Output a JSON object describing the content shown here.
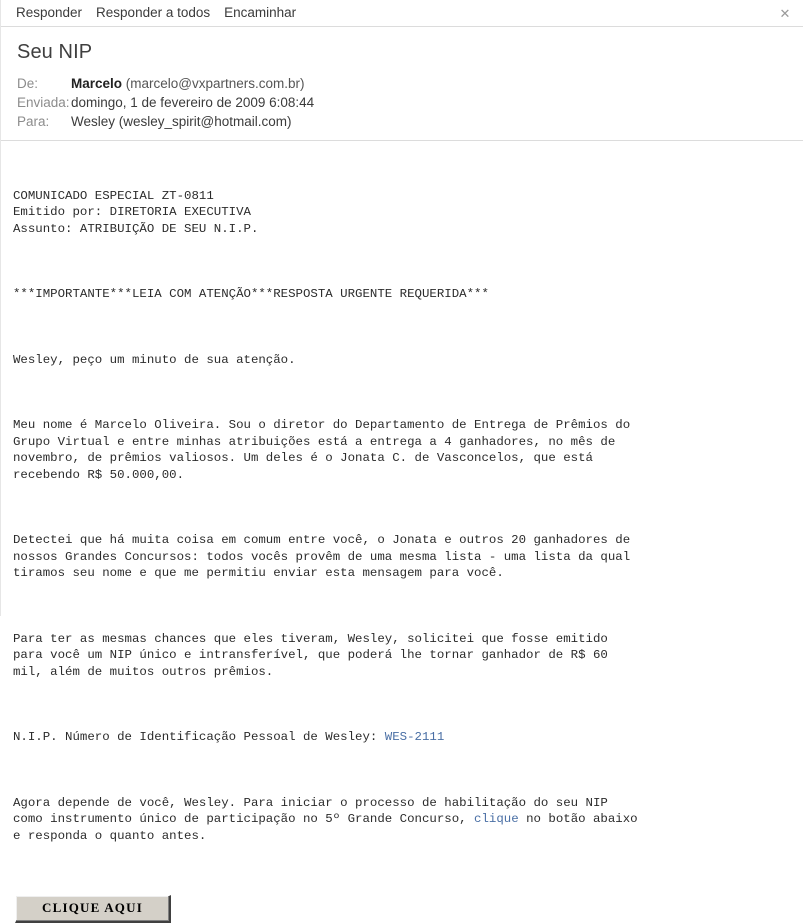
{
  "toolbar": {
    "actions": [
      {
        "label": "Responder",
        "name": "reply-button"
      },
      {
        "label": "Responder a todos",
        "name": "reply-all-button"
      },
      {
        "label": "Encaminhar",
        "name": "forward-button"
      }
    ],
    "close_icon": "✕"
  },
  "message": {
    "subject": "Seu NIP",
    "fields": {
      "from_label": "De:",
      "from_name": "Marcelo",
      "from_address": "(marcelo@vxpartners.com.br)",
      "sent_label": "Enviada:",
      "sent_value": "domingo, 1 de fevereiro de 2009 6:08:44",
      "to_label": "Para:",
      "to_value": "Wesley (wesley_spirit@hotmail.com)"
    },
    "body": {
      "block_header": "COMUNICADO ESPECIAL ZT-0811\nEmitido por: DIRETORIA EXECUTIVA\nAssunto: ATRIBUIÇÃO DE SEU N.I.P.",
      "attention_line": "***IMPORTANTE***LEIA COM ATENÇÃO***RESPOSTA URGENTE REQUERIDA***",
      "greeting": "Wesley, peço um minuto de sua atenção.",
      "paragraph_1": "Meu nome é Marcelo Oliveira. Sou o diretor do Departamento de Entrega de Prêmios do\nGrupo Virtual e entre minhas atribuições está a entrega a 4 ganhadores, no mês de\nnovembro, de prêmios valiosos. Um deles é o Jonata C. de Vasconcelos, que está\nrecebendo R$ 50.000,00.",
      "paragraph_2": "Detectei que há muita coisa em comum entre você, o Jonata e outros 20 ganhadores de\nnossos Grandes Concursos: todos vocês provêm de uma mesma lista - uma lista da qual\ntiramos seu nome e que me permitiu enviar esta mensagem para você.",
      "paragraph_3": "Para ter as mesmas chances que eles tiveram, Wesley, solicitei que fosse emitido\npara você um NIP único e intransferível, que poderá lhe tornar ganhador de R$ 60\nmil, além de muitos outros prêmios.",
      "nip_line_prefix": "N.I.P. Número de Identificação Pessoal de Wesley: ",
      "nip_code": "WES-2111",
      "closing_part_1": "Agora depende de você, Wesley. Para iniciar o processo de habilitação do seu NIP\ncomo instrumento único de participação no 5º Grande Concurso, ",
      "closing_link": "clique",
      "closing_part_2": " no botão abaixo\ne responda o quanto antes."
    },
    "cta_label": "CLIQUE AQUI"
  },
  "colors": {
    "link": "#4a6fa5",
    "button_face": "#d4d0c8",
    "divider": "#dcdcdc"
  }
}
